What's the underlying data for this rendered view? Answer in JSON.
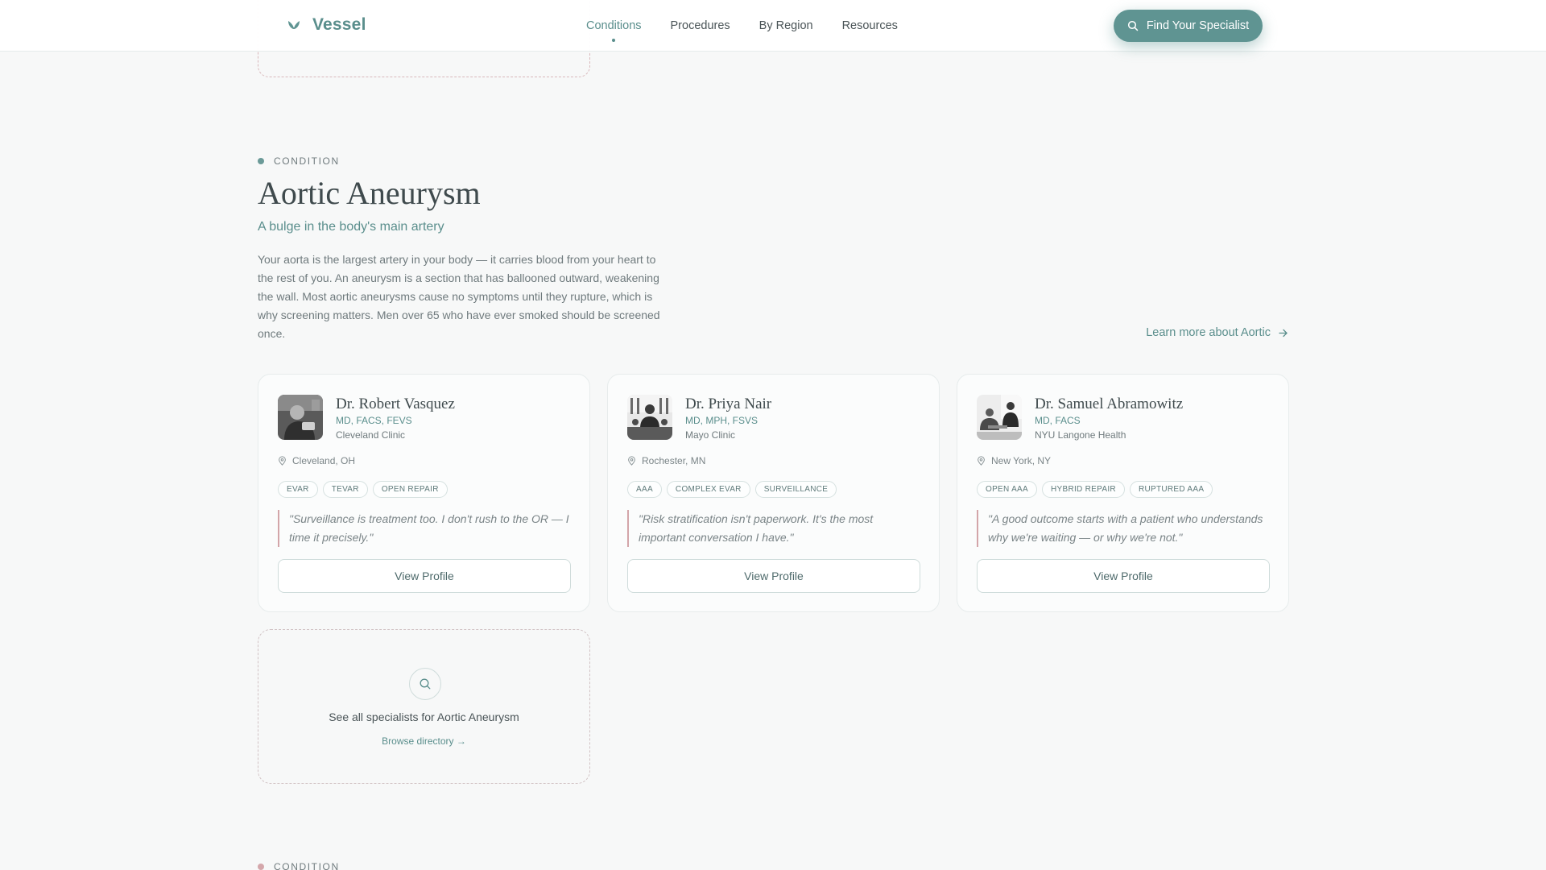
{
  "header": {
    "brand": "Vessel",
    "nav": [
      {
        "label": "Conditions",
        "active": true
      },
      {
        "label": "Procedures",
        "active": false
      },
      {
        "label": "By Region",
        "active": false
      },
      {
        "label": "Resources",
        "active": false
      }
    ],
    "cta_label": "Find Your Specialist"
  },
  "section": {
    "eyebrow": "CONDITION",
    "title": "Aortic Aneurysm",
    "subtitle": "A bulge in the body's main artery",
    "description": "Your aorta is the largest artery in your body — it carries blood from your heart to the rest of you. An aneurysm is a section that has ballooned outward, weakening the wall. Most aortic aneurysms cause no symptoms until they rupture, which is why screening matters. Men over 65 who have ever smoked should be screened once.",
    "learn_more": "Learn more about Aortic"
  },
  "specialists": [
    {
      "name": "Dr. Robert Vasquez",
      "credentials": "MD, FACS, FEVS",
      "organization": "Cleveland Clinic",
      "location": "Cleveland, OH",
      "tags": [
        "EVAR",
        "TEVAR",
        "OPEN REPAIR"
      ],
      "quote": "\"Surveillance is treatment too. I don't rush to the OR — I time it precisely.\"",
      "view_label": "View Profile"
    },
    {
      "name": "Dr. Priya Nair",
      "credentials": "MD, MPH, FSVS",
      "organization": "Mayo Clinic",
      "location": "Rochester, MN",
      "tags": [
        "AAA",
        "COMPLEX EVAR",
        "SURVEILLANCE"
      ],
      "quote": "\"Risk stratification isn't paperwork. It's the most important conversation I have.\"",
      "view_label": "View Profile"
    },
    {
      "name": "Dr. Samuel Abramowitz",
      "credentials": "MD, FACS",
      "organization": "NYU Langone Health",
      "location": "New York, NY",
      "tags": [
        "OPEN AAA",
        "HYBRID REPAIR",
        "RUPTURED AAA"
      ],
      "quote": "\"A good outcome starts with a patient who understands why we're waiting — or why we're not.\"",
      "view_label": "View Profile"
    }
  ],
  "browse": {
    "label": "See all specialists for Aortic Aneurysm",
    "link": "Browse directory →"
  },
  "next_section": {
    "eyebrow": "CONDITION"
  },
  "colors": {
    "accent": "#5f9492",
    "quote_rule": "#d3a5a9",
    "background": "#f7f8f8"
  }
}
